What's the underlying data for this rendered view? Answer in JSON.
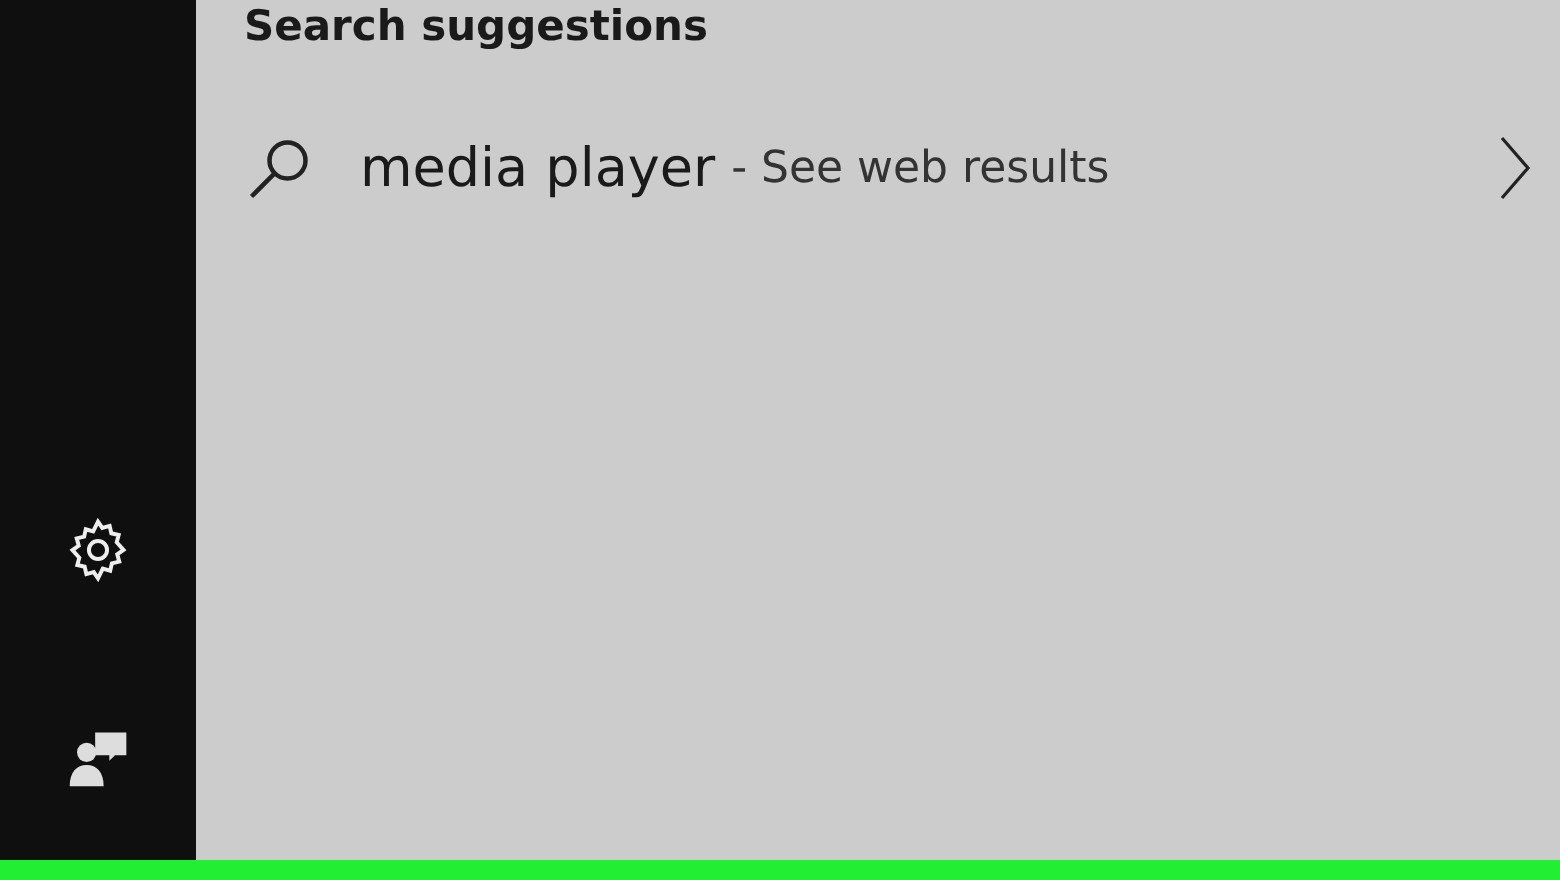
{
  "sidebar": {
    "items": [
      {
        "kind": "settings"
      },
      {
        "kind": "feedback"
      }
    ]
  },
  "search_suggestions": {
    "heading": "Search suggestions",
    "items": [
      {
        "query": "media player",
        "hint": "- See web results"
      }
    ]
  }
}
